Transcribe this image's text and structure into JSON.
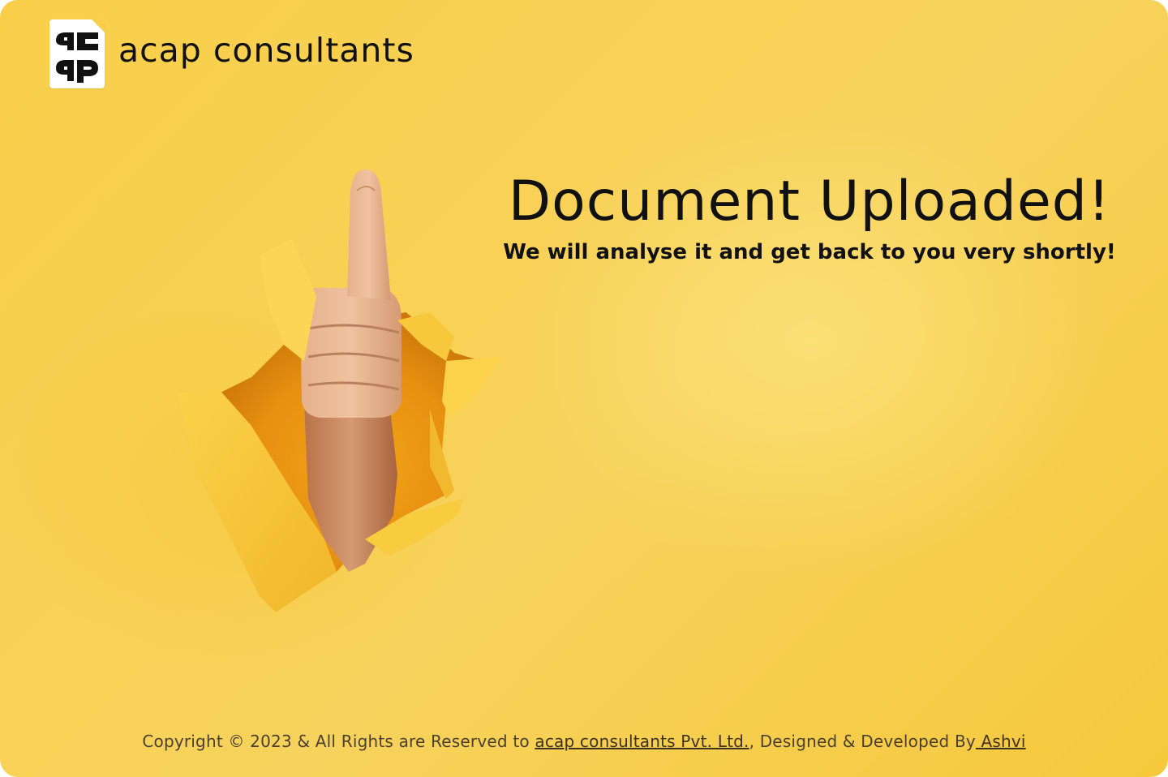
{
  "brand": {
    "logo_text": "acap",
    "name": "acap consultants"
  },
  "main": {
    "headline": "Document Uploaded!",
    "subline": "We will analyse it and get back to you very shortly!"
  },
  "illustration": {
    "icon": "thumbs-up-through-paper"
  },
  "footer": {
    "prefix": "Copyright © 2023 & All Rights are Reserved to ",
    "company_link": "acap consultants Pvt. Ltd.",
    "middle": ", Designed & Developed By",
    "developer_link": " Ashvi"
  },
  "colors": {
    "background": "#f8d155",
    "text": "#111111"
  }
}
